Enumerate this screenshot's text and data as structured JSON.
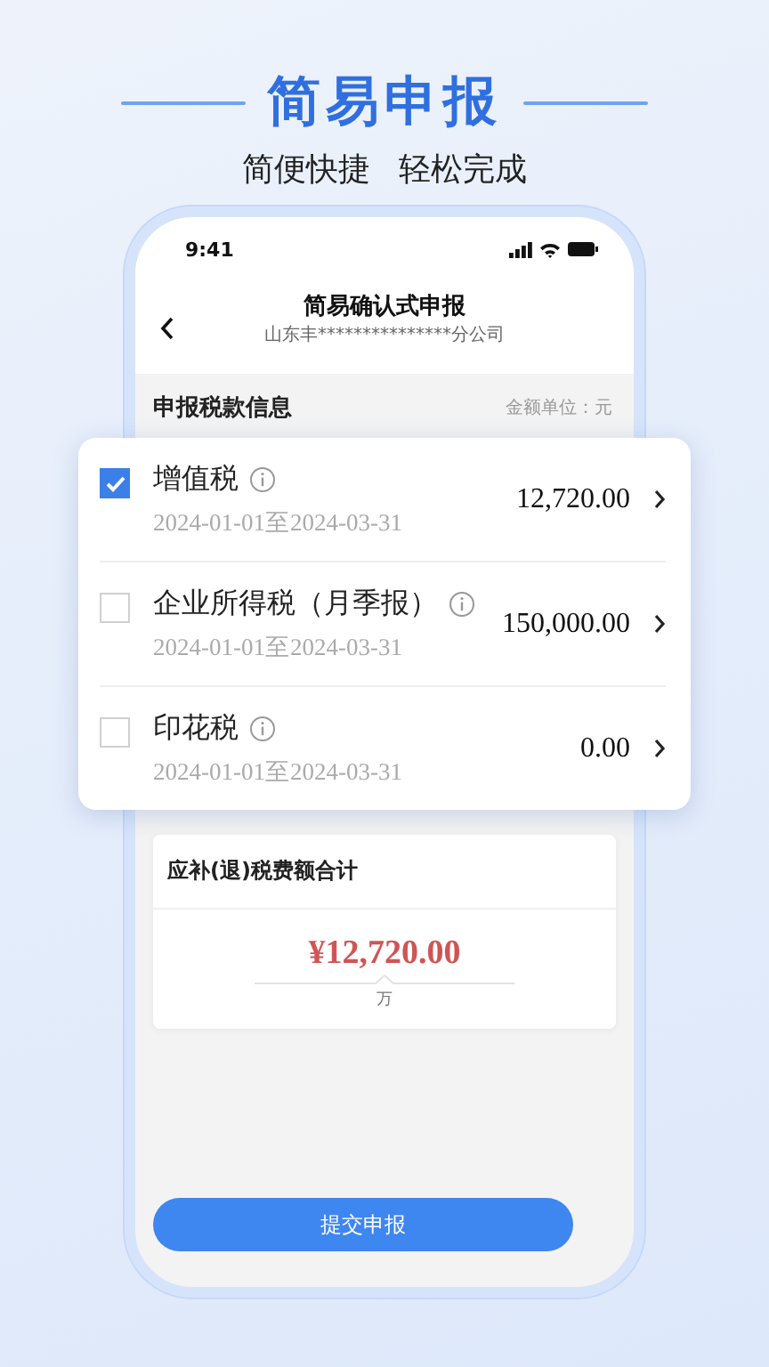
{
  "header": {
    "title": "简易申报",
    "taglines": [
      "简便快捷",
      "轻松完成"
    ]
  },
  "status_bar": {
    "time": "9:41"
  },
  "nav": {
    "title": "简易确认式申报",
    "subtitle": "山东丰***************分公司"
  },
  "section": {
    "title": "申报税款信息",
    "unit": "金额单位：元"
  },
  "taxes": [
    {
      "name": "增值税",
      "period": "2024-01-01至2024-03-31",
      "amount": "12,720.00",
      "checked": true
    },
    {
      "name": "企业所得税（月季报）",
      "period": "2024-01-01至2024-03-31",
      "amount": "150,000.00",
      "checked": false
    },
    {
      "name": "印花税",
      "period": "2024-01-01至2024-03-31",
      "amount": "0.00",
      "checked": false
    }
  ],
  "summary": {
    "title": "应补(退)税费额合计",
    "amount": "¥12,720.00",
    "unit": "万"
  },
  "submit_button": "提交申报"
}
